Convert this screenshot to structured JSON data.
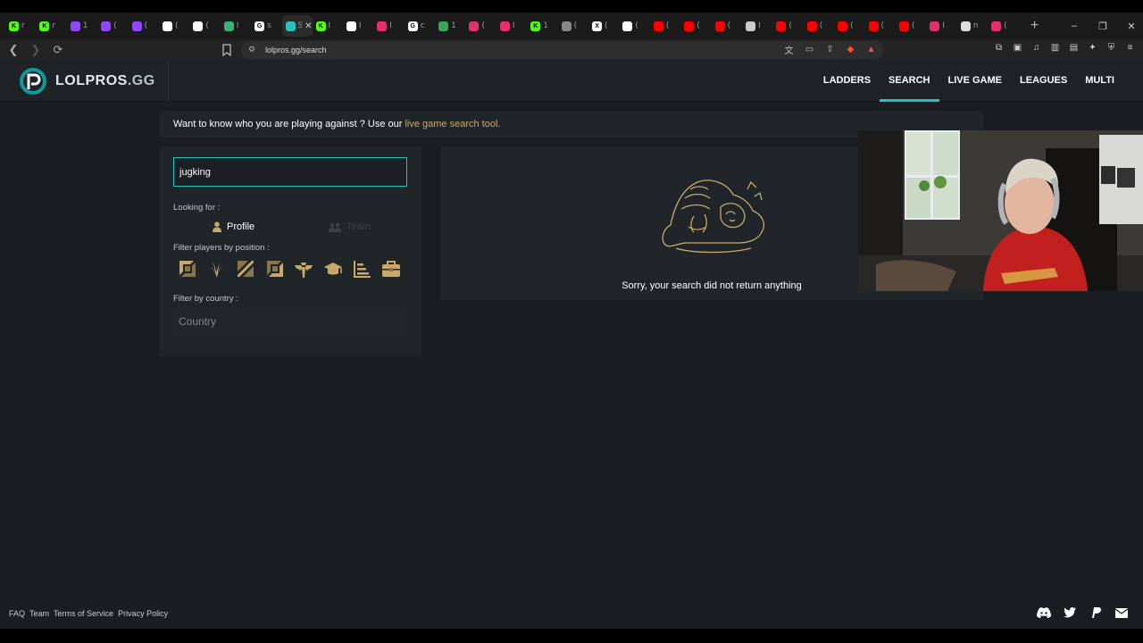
{
  "browser": {
    "tabs": [
      {
        "icon": "kick-icon",
        "color": "#53fc18",
        "letter": "K",
        "title": "r"
      },
      {
        "icon": "kick-icon",
        "color": "#53fc18",
        "letter": "K",
        "title": "r"
      },
      {
        "icon": "twitch-icon",
        "color": "#9146ff",
        "letter": "",
        "title": "1"
      },
      {
        "icon": "twitch-icon",
        "color": "#9146ff",
        "letter": "",
        "title": "("
      },
      {
        "icon": "twitch-icon",
        "color": "#9146ff",
        "letter": "",
        "title": "("
      },
      {
        "icon": "tiktok-icon",
        "color": "#ffffff",
        "letter": "",
        "title": "("
      },
      {
        "icon": "tiktok-icon",
        "color": "#ffffff",
        "letter": "",
        "title": "("
      },
      {
        "icon": "app-icon",
        "color": "#3db07a",
        "letter": "",
        "title": "I"
      },
      {
        "icon": "google-icon",
        "color": "#ffffff",
        "letter": "G",
        "title": "s"
      },
      {
        "icon": "site-icon",
        "color": "#2ac1bc",
        "letter": "",
        "title": "S",
        "active": true
      },
      {
        "icon": "kick-icon",
        "color": "#53fc18",
        "letter": "K",
        "title": "I"
      },
      {
        "icon": "tiktok-icon",
        "color": "#ffffff",
        "letter": "",
        "title": "I"
      },
      {
        "icon": "instagram-icon",
        "color": "#e1306c",
        "letter": "",
        "title": "I"
      },
      {
        "icon": "google-icon",
        "color": "#ffffff",
        "letter": "G",
        "title": "c"
      },
      {
        "icon": "maps-icon",
        "color": "#34a853",
        "letter": "",
        "title": "1"
      },
      {
        "icon": "instagram-icon",
        "color": "#e1306c",
        "letter": "",
        "title": "("
      },
      {
        "icon": "instagram-icon",
        "color": "#e1306c",
        "letter": "",
        "title": "I"
      },
      {
        "icon": "kick-icon",
        "color": "#53fc18",
        "letter": "K",
        "title": "1"
      },
      {
        "icon": "globe-icon",
        "color": "#888888",
        "letter": "",
        "title": "("
      },
      {
        "icon": "x-icon",
        "color": "#ffffff",
        "letter": "X",
        "title": "("
      },
      {
        "icon": "tiktok-icon",
        "color": "#ffffff",
        "letter": "",
        "title": "("
      },
      {
        "icon": "youtube-icon",
        "color": "#ff0000",
        "letter": "",
        "title": "("
      },
      {
        "icon": "youtube-icon",
        "color": "#ff0000",
        "letter": "",
        "title": "("
      },
      {
        "icon": "youtube-icon",
        "color": "#ff0000",
        "letter": "",
        "title": "("
      },
      {
        "icon": "globe-icon",
        "color": "#cccccc",
        "letter": "",
        "title": "I"
      },
      {
        "icon": "youtube-icon",
        "color": "#ff0000",
        "letter": "",
        "title": "("
      },
      {
        "icon": "youtube-icon",
        "color": "#ff0000",
        "letter": "",
        "title": "("
      },
      {
        "icon": "youtube-icon",
        "color": "#ff0000",
        "letter": "",
        "title": "("
      },
      {
        "icon": "youtube-icon",
        "color": "#ff0000",
        "letter": "",
        "title": "("
      },
      {
        "icon": "youtube-icon",
        "color": "#ff0000",
        "letter": "",
        "title": "("
      },
      {
        "icon": "instagram-icon",
        "color": "#e1306c",
        "letter": "",
        "title": "I"
      },
      {
        "icon": "speaker-icon",
        "color": "#dddddd",
        "letter": "",
        "title": "n"
      },
      {
        "icon": "instagram-icon",
        "color": "#e1306c",
        "letter": "",
        "title": "("
      }
    ],
    "url": "lolpros.gg/search"
  },
  "site": {
    "logo_main": "LOLPROS",
    "logo_suffix": ".GG",
    "nav": [
      "LADDERS",
      "SEARCH",
      "LIVE GAME",
      "LEAGUES",
      "MULTI"
    ],
    "active_nav": "SEARCH",
    "accent_color": "#2ac1bc",
    "gold_color": "#c8a96a"
  },
  "banner": {
    "text": "Want to know who you are playing against ? Use our ",
    "link": "live game search tool."
  },
  "search": {
    "query": "jugking",
    "looking_for_label": "Looking for :",
    "profile_label": "Profile",
    "team_label": "Team",
    "position_label": "Filter players by position :",
    "country_label": "Filter by country :",
    "country_placeholder": "Country"
  },
  "results": {
    "empty_message": "Sorry, your search did not return anything"
  },
  "footer": {
    "links": [
      "FAQ",
      "Team",
      "Terms of Service",
      "Privacy Policy"
    ],
    "social": [
      "discord-icon",
      "twitter-icon",
      "paypal-icon",
      "mail-icon"
    ]
  }
}
